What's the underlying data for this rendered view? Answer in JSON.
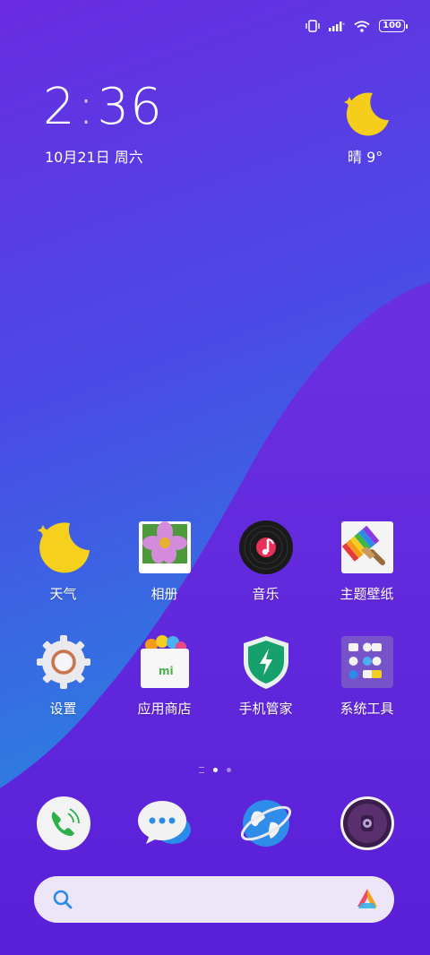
{
  "status_bar": {
    "battery": "100",
    "icons": [
      "vibrate-icon",
      "signal-icon",
      "wifi-icon",
      "battery-icon"
    ]
  },
  "clock": {
    "hour": "2",
    "minute": "36"
  },
  "date": "10月21日 周六",
  "weather": {
    "text": "晴  9°",
    "icon": "moon-icon"
  },
  "apps_row1": [
    {
      "name": "weather",
      "label": "天气",
      "icon": "moon-icon"
    },
    {
      "name": "gallery",
      "label": "相册",
      "icon": "flower-photo-icon"
    },
    {
      "name": "music",
      "label": "音乐",
      "icon": "vinyl-icon"
    },
    {
      "name": "themes",
      "label": "主题壁纸",
      "icon": "paint-brush-icon"
    }
  ],
  "apps_row2": [
    {
      "name": "settings",
      "label": "设置",
      "icon": "gear-icon"
    },
    {
      "name": "app-store",
      "label": "应用商店",
      "icon": "store-bag-icon"
    },
    {
      "name": "security",
      "label": "手机管家",
      "icon": "shield-bolt-icon"
    },
    {
      "name": "tools",
      "label": "系统工具",
      "icon": "folder-icon"
    }
  ],
  "page_indicator": {
    "pages": 2,
    "active": 0
  },
  "dock": [
    {
      "name": "phone",
      "icon": "phone-icon"
    },
    {
      "name": "messages",
      "icon": "chat-bubble-icon"
    },
    {
      "name": "browser",
      "icon": "globe-icon"
    },
    {
      "name": "camera",
      "icon": "camera-icon"
    }
  ],
  "search": {
    "placeholder": "",
    "icon": "search-icon",
    "assistant_icon": "assistant-logo-icon"
  },
  "colors": {
    "bg_top": "#6a2be0",
    "bg_bottom": "#2a86dc",
    "wave": "#6b2fe0",
    "search_bg": "#ece6f8"
  }
}
